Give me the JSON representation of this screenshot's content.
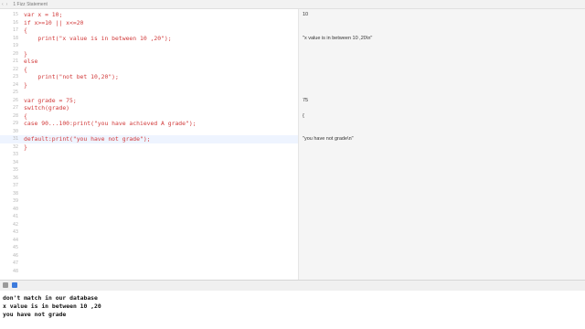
{
  "window": {
    "title": "1 Fizz Statement",
    "nav": [
      "‹",
      "›"
    ]
  },
  "editor": {
    "lines": [
      {
        "num": "15",
        "code": "var x = 10;"
      },
      {
        "num": "16",
        "code": "if x>=10 || x<=20"
      },
      {
        "num": "17",
        "code": "{"
      },
      {
        "num": "18",
        "code": "    print(\"x value is in between 10 ,20\");"
      },
      {
        "num": "19",
        "code": ""
      },
      {
        "num": "20",
        "code": "}"
      },
      {
        "num": "21",
        "code": "else"
      },
      {
        "num": "22",
        "code": "{"
      },
      {
        "num": "23",
        "code": "    print(\"not bet 10,20\");"
      },
      {
        "num": "24",
        "code": "}"
      },
      {
        "num": "25",
        "code": ""
      },
      {
        "num": "26",
        "code": "var grade = 75;"
      },
      {
        "num": "27",
        "code": "switch(grade)"
      },
      {
        "num": "28",
        "code": "{"
      },
      {
        "num": "29",
        "code": "case 90...100:print(\"you have achieved A grade\");"
      },
      {
        "num": "30",
        "code": ""
      },
      {
        "num": "31",
        "code": "default:print(\"you have not grade\");"
      },
      {
        "num": "32",
        "code": "}"
      },
      {
        "num": "33",
        "code": ""
      },
      {
        "num": "34",
        "code": ""
      },
      {
        "num": "35",
        "code": ""
      },
      {
        "num": "36",
        "code": ""
      },
      {
        "num": "37",
        "code": ""
      },
      {
        "num": "38",
        "code": ""
      },
      {
        "num": "39",
        "code": ""
      },
      {
        "num": "40",
        "code": ""
      },
      {
        "num": "41",
        "code": ""
      },
      {
        "num": "42",
        "code": ""
      },
      {
        "num": "43",
        "code": ""
      },
      {
        "num": "44",
        "code": ""
      },
      {
        "num": "45",
        "code": ""
      },
      {
        "num": "46",
        "code": ""
      },
      {
        "num": "47",
        "code": ""
      },
      {
        "num": "48",
        "code": ""
      }
    ],
    "current_line_index": 16
  },
  "results": [
    {
      "line_index": 0,
      "text": "10"
    },
    {
      "line_index": 3,
      "text": "\"x value is in between 10 ,20\\n\""
    },
    {
      "line_index": 11,
      "text": "75"
    },
    {
      "line_index": 13,
      "text": "{"
    },
    {
      "line_index": 16,
      "text": "\"you have not grade\\n\""
    }
  ],
  "console": {
    "lines": [
      "don't match in our database",
      "x value is in between 10 ,20",
      "you have not grade"
    ]
  },
  "colors": {
    "code": "#d13a3a",
    "run_button": "#3d7bdc"
  }
}
